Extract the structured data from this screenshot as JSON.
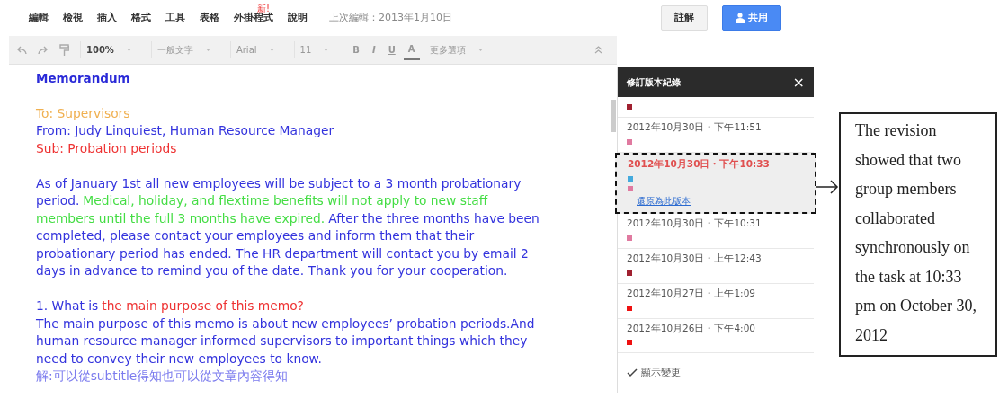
{
  "menu_bar": {
    "items": [
      {
        "label": "編輯"
      },
      {
        "label": "檢視"
      },
      {
        "label": "插入"
      },
      {
        "label": "格式"
      },
      {
        "label": "工具"
      },
      {
        "label": "表格"
      },
      {
        "label": "外掛程式",
        "badge": "新!"
      },
      {
        "label": "說明"
      }
    ],
    "last_edit": "上次編輯：2013年1月10日"
  },
  "header_buttons": [
    {
      "label": "註解",
      "kind": "plain"
    },
    {
      "label": "共用",
      "kind": "primary"
    }
  ],
  "toolbar": {
    "items": [
      {
        "kind": "dropdown",
        "label": "100%",
        "bold": true
      },
      {
        "kind": "dropdown",
        "label": "一般文字"
      },
      {
        "kind": "dropdown",
        "label": "Arial"
      },
      {
        "kind": "dropdown",
        "label": "11"
      },
      {
        "kind": "format",
        "label": "B"
      },
      {
        "kind": "format",
        "label": "I"
      },
      {
        "kind": "format",
        "label": "U"
      },
      {
        "kind": "format",
        "label": "A"
      },
      {
        "kind": "dropdown",
        "label": "更多選項"
      }
    ]
  },
  "document": {
    "title": "Memorandum",
    "paragraphs": [
      {
        "lines": [
          [
            {
              "text": "To: Supervisors",
              "color": "#f0b050"
            }
          ],
          [
            {
              "text": "From: Judy Linquiest, Human Resource Manager",
              "color": "#3333dd"
            }
          ],
          [
            {
              "text": "Sub: Probation periods",
              "color": "#ee3333"
            }
          ]
        ]
      },
      {
        "lines": [
          [
            {
              "text": "As of January 1st all new employees will be subject to a 3 month probationary",
              "color": "#3333dd"
            }
          ],
          [
            {
              "text": "period.",
              "color": "#3333dd"
            },
            {
              "text": "Medical, holiday, and flextime benefits will not apply to new staff",
              "color": "#44dd44"
            }
          ],
          [
            {
              "text": "members until the full 3 months have expired.",
              "color": "#44dd44"
            },
            {
              "text": "After the three months have been",
              "color": "#3333dd"
            }
          ],
          [
            {
              "text": "completed, please contact your employees and inform them that their",
              "color": "#3333dd"
            }
          ],
          [
            {
              "text": "probationary period has ended. The HR department will contact you by email 2",
              "color": "#3333dd"
            }
          ],
          [
            {
              "text": "days in advance to remind you of the date. Thank you for your cooperation.",
              "color": "#3333dd"
            }
          ]
        ]
      },
      {
        "lines": [
          [
            {
              "text": "1. What is ",
              "color": "#3333dd"
            },
            {
              "text": "the main purpose of this memo?",
              "color": "#ee3333"
            }
          ],
          [
            {
              "text": "The main purpose of this memo is about new employees’  probation periods.And",
              "color": "#3333dd"
            }
          ],
          [
            {
              "text": "human resource manager informed supervisors to important things which they",
              "color": "#3333dd"
            }
          ],
          [
            {
              "text": "need to convey their new employees to know.",
              "color": "#3333dd"
            }
          ],
          [
            {
              "text": "解:可以從subtitle得知也可以從文章內容得知",
              "color": "#7b7bee"
            }
          ]
        ]
      }
    ]
  },
  "revision_panel": {
    "title": "修訂版本紀錄",
    "close": "×",
    "revisions": [
      {
        "squares": [
          {
            "color": "#a02030"
          }
        ],
        "selected": false
      },
      {
        "date": "2012年10月30日・下午11:51",
        "squares": [
          {
            "color": "#e07aa0"
          }
        ],
        "selected": false
      },
      {
        "date": "2012年10月30日・下午10:33",
        "squares": [
          {
            "color": "#44aadd"
          },
          {
            "color": "#e07aa0"
          }
        ],
        "link": "還原為此版本",
        "selected": true
      },
      {
        "date": "2012年10月30日・下午10:31",
        "squares": [
          {
            "color": "#e07aa0"
          }
        ],
        "selected": false
      },
      {
        "date": "2012年10月30日・上午12:43",
        "squares": [
          {
            "color": "#a02030"
          }
        ],
        "selected": false
      },
      {
        "date": "2012年10月27日・上午1:09",
        "squares": [
          {
            "color": "#ee1111"
          }
        ],
        "selected": false
      },
      {
        "date": "2012年10月26日・下午4:00",
        "squares": [
          {
            "color": "#ee1111"
          }
        ],
        "selected": false
      }
    ],
    "show_changes": {
      "label": "顯示變更",
      "checked": true
    }
  },
  "annotation": {
    "text": "The revision showed that two group members collaborated synchronously on the task at 10:33 pm on October 30, 2012"
  }
}
